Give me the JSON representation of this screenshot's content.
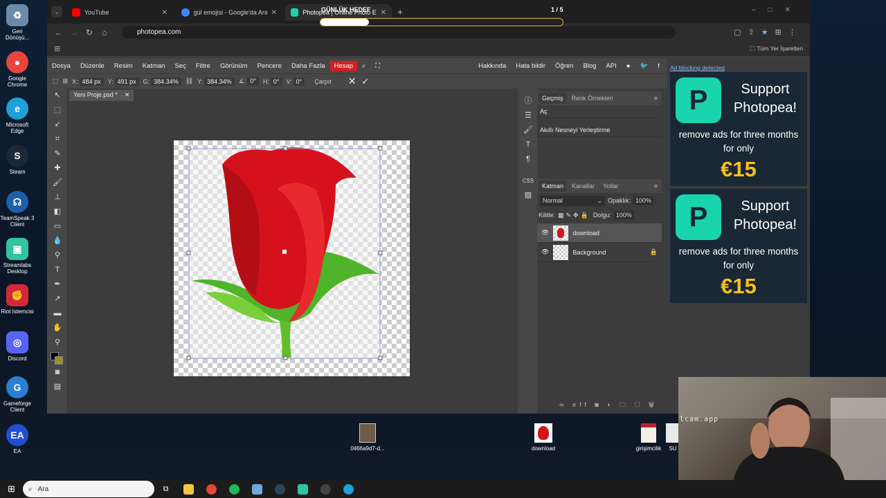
{
  "desktop": {
    "icons": [
      {
        "label": "Geri Dönüşü...",
        "icon": "recycle-bin-icon",
        "color": "#6a8aa8"
      },
      {
        "label": "Google Chrome",
        "icon": "chrome-icon",
        "color": "#e8453c"
      },
      {
        "label": "Microsoft Edge",
        "icon": "edge-icon",
        "color": "#1fa0d8"
      },
      {
        "label": "Steam",
        "icon": "steam-icon",
        "color": "#1b2838"
      },
      {
        "label": "TeamSpeak 3 Client",
        "icon": "teamspeak-icon",
        "color": "#1e5fa8"
      },
      {
        "label": "Streamlabs Desktop",
        "icon": "streamlabs-icon",
        "color": "#31c3a2"
      },
      {
        "label": "Riot İstemcisi",
        "icon": "riot-icon",
        "color": "#d32936"
      },
      {
        "label": "Discord",
        "icon": "discord-icon",
        "color": "#5865f2"
      },
      {
        "label": "Gameforge Client",
        "icon": "gameforge-icon",
        "color": "#2a7fd0"
      },
      {
        "label": "EA",
        "icon": "ea-icon",
        "color": "#1f4fd0"
      }
    ],
    "files": [
      {
        "label": "0466a9d7-d...",
        "icon": "image-file-icon"
      },
      {
        "label": "download",
        "icon": "rose-image-icon"
      },
      {
        "label": "girişimcilik",
        "icon": "document-icon"
      },
      {
        "label": "SU",
        "icon": "file-icon"
      }
    ]
  },
  "overlay": {
    "goal_title": "GÜNLÜK HEDEF",
    "goal_count": "1 / 5",
    "goal_progress": 0.2,
    "cam_watermark": "lcam.app"
  },
  "browser": {
    "tabs": [
      {
        "title": "YouTube",
        "color": "#ff0000"
      },
      {
        "title": "gül emojisi - Google'da Ara",
        "color": "#4285f4"
      },
      {
        "title": "Photopea | Online Photo Editor",
        "color": "#1ad4b0"
      }
    ],
    "url": "photopea.com",
    "bookmarks_label": "Tüm Yer İşaretleri"
  },
  "photopea": {
    "menu": [
      "Dosya",
      "Düzenle",
      "Resim",
      "Katman",
      "Seç",
      "Filtre",
      "Görünüm",
      "Pencere",
      "Daha Fazla"
    ],
    "menu_account": "Hesap",
    "links": [
      "Hakkında",
      "Hata bildir",
      "Öğren",
      "Blog",
      "API"
    ],
    "options": {
      "x_label": "X:",
      "x": "484 px",
      "y_label": "Y:",
      "y": "491 px",
      "w_label": "G:",
      "w": "384.34%",
      "h_label": "Y:",
      "h": "384.34%",
      "angle_label": "∡:",
      "angle": "0°",
      "hskew_label": "H:",
      "hskew": "0°",
      "vskew_label": "V:",
      "vskew": "0°",
      "warp": "Çarpıt"
    },
    "doc_tab": "Yeni Proje.psd *",
    "history": {
      "tabs": [
        "Geçmiş",
        "Renk Örnekleri"
      ],
      "items": [
        "Aç",
        "Akıllı Nesneyi Yerleştirme"
      ]
    },
    "layers_panel": {
      "tabs": [
        "Katman",
        "Kanallar",
        "Yollar"
      ],
      "blend": "Normal",
      "opacity_label": "Opaklık:",
      "opacity": "100%",
      "lock_label": "Kilitle:",
      "fill_label": "Dolgu:",
      "fill": "100%",
      "layers": [
        "download",
        "Background"
      ]
    },
    "ads": {
      "notice": "Ad blocking detected",
      "headline": "Support Photopea!",
      "sub": "remove ads for three months for only",
      "price": "€15"
    }
  },
  "taskbar": {
    "search": "Ara"
  }
}
